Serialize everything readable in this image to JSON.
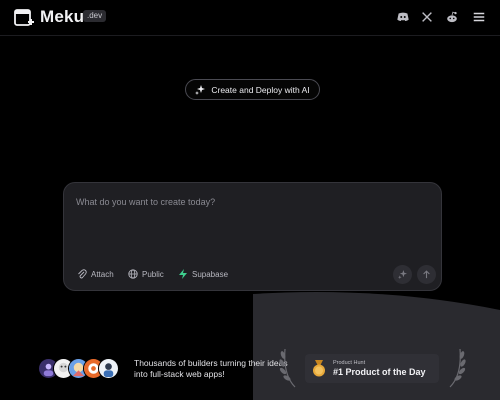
{
  "header": {
    "brand": "Meku",
    "badge": ".dev",
    "icons": [
      "discord-icon",
      "x-icon",
      "reddit-icon",
      "menu-icon"
    ]
  },
  "pill": {
    "label": "Create and Deploy with AI",
    "icon": "sparkle-icon"
  },
  "prompt": {
    "placeholder": "What do you want to create today?",
    "value": ""
  },
  "toolbar": {
    "attach": "Attach",
    "public": "Public",
    "supabase": "Supabase"
  },
  "social_proof": {
    "tagline": "Thousands of builders turning their ideas into full-stack web apps!"
  },
  "product_hunt": {
    "eyebrow": "Product Hunt",
    "title": "#1 Product of the Day"
  },
  "colors": {
    "background": "#000000",
    "card": "#1f1f23",
    "supabase_green": "#3ecf8e",
    "medal_gold": "#e8a93a"
  }
}
